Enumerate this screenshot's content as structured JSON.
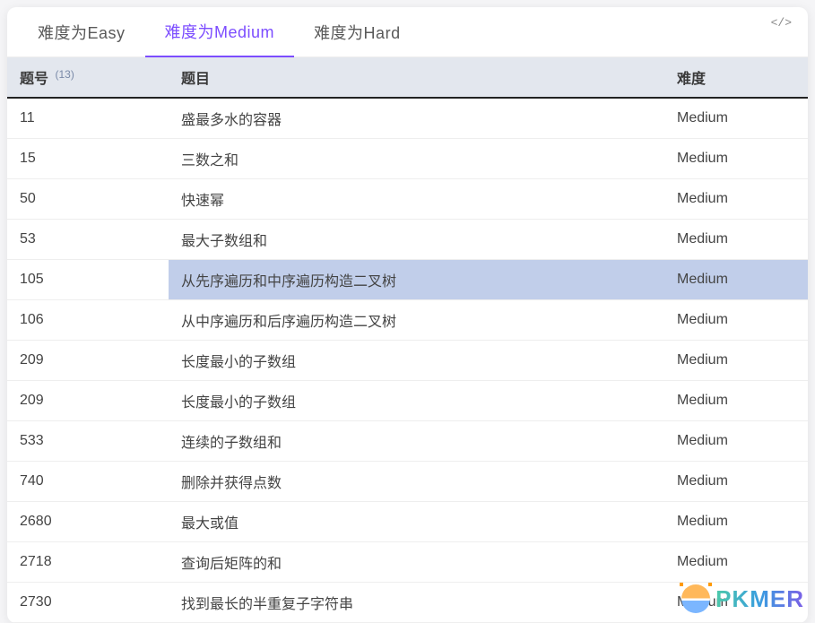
{
  "tabs": [
    {
      "label": "难度为Easy",
      "active": false
    },
    {
      "label": "难度为Medium",
      "active": true
    },
    {
      "label": "难度为Hard",
      "active": false
    }
  ],
  "code_icon": "</>",
  "table": {
    "headers": {
      "id": "题号",
      "count": "(13)",
      "title": "题目",
      "difficulty": "难度"
    },
    "rows": [
      {
        "id": "11",
        "title": "盛最多水的容器",
        "difficulty": "Medium",
        "selected": false
      },
      {
        "id": "15",
        "title": "三数之和",
        "difficulty": "Medium",
        "selected": false
      },
      {
        "id": "50",
        "title": "快速幂",
        "difficulty": "Medium",
        "selected": false
      },
      {
        "id": "53",
        "title": "最大子数组和",
        "difficulty": "Medium",
        "selected": false
      },
      {
        "id": "105",
        "title": "从先序遍历和中序遍历构造二叉树",
        "difficulty": "Medium",
        "selected": true
      },
      {
        "id": "106",
        "title": "从中序遍历和后序遍历构造二叉树",
        "difficulty": "Medium",
        "selected": false
      },
      {
        "id": "209",
        "title": "长度最小的子数组",
        "difficulty": "Medium",
        "selected": false
      },
      {
        "id": "209",
        "title": "长度最小的子数组",
        "difficulty": "Medium",
        "selected": false
      },
      {
        "id": "533",
        "title": "连续的子数组和",
        "difficulty": "Medium",
        "selected": false
      },
      {
        "id": "740",
        "title": "删除并获得点数",
        "difficulty": "Medium",
        "selected": false
      },
      {
        "id": "2680",
        "title": "最大或值",
        "difficulty": "Medium",
        "selected": false
      },
      {
        "id": "2718",
        "title": "查询后矩阵的和",
        "difficulty": "Medium",
        "selected": false
      },
      {
        "id": "2730",
        "title": "找到最长的半重复子字符串",
        "difficulty": "Medium",
        "selected": false
      }
    ]
  },
  "watermark": "PKMER"
}
